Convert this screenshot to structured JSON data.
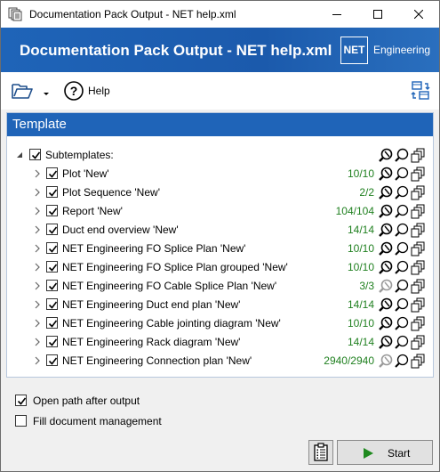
{
  "window": {
    "title": "Documentation Pack Output - NET help.xml",
    "controls": [
      "minimize",
      "maximize",
      "close"
    ]
  },
  "banner": {
    "title": "Documentation Pack Output - NET help.xml",
    "logo_mark": "NET",
    "logo_text": "Engineering",
    "color": "#1f64b8"
  },
  "toolbar": {
    "open_icon": "folder-open-icon",
    "dropdown_icon": "chevron-down-icon",
    "help_icon": "help-circle-icon",
    "help_label": "Help",
    "right_icon": "layout-switch-icon"
  },
  "template": {
    "header": "Template",
    "root": {
      "label": "Subtemplates:",
      "checked": true,
      "expanded": true
    },
    "items": [
      {
        "label": "Plot 'New'",
        "count": "10/10",
        "checked": true,
        "active": true
      },
      {
        "label": "Plot Sequence 'New'",
        "count": "2/2",
        "checked": true,
        "active": true
      },
      {
        "label": "Report 'New'",
        "count": "104/104",
        "checked": true,
        "active": true
      },
      {
        "label": "Duct end overview 'New'",
        "count": "14/14",
        "checked": true,
        "active": true
      },
      {
        "label": "NET Engineering FO Splice Plan 'New'",
        "count": "10/10",
        "checked": true,
        "active": true
      },
      {
        "label": "NET Engineering FO Splice Plan grouped 'New'",
        "count": "10/10",
        "checked": true,
        "active": true
      },
      {
        "label": "NET Engineering FO Cable Splice Plan 'New'",
        "count": "3/3",
        "checked": true,
        "active": false
      },
      {
        "label": "NET Engineering Duct end plan 'New'",
        "count": "14/14",
        "checked": true,
        "active": true
      },
      {
        "label": "NET Engineering Cable jointing diagram 'New'",
        "count": "10/10",
        "checked": true,
        "active": true
      },
      {
        "label": "NET Engineering Rack diagram 'New'",
        "count": "14/14",
        "checked": true,
        "active": true
      },
      {
        "label": "NET Engineering Connection plan 'New'",
        "count": "2940/2940",
        "checked": true,
        "active": false
      }
    ],
    "count_color": "#208020"
  },
  "options": {
    "open_path": {
      "label": "Open path after output",
      "checked": true
    },
    "fill_docmgmt": {
      "label": "Fill document management",
      "checked": false
    }
  },
  "buttons": {
    "clipboard_icon": "clipboard-list-icon",
    "start_label": "Start",
    "start_icon": "play-icon",
    "start_color": "#1f8a1f"
  }
}
